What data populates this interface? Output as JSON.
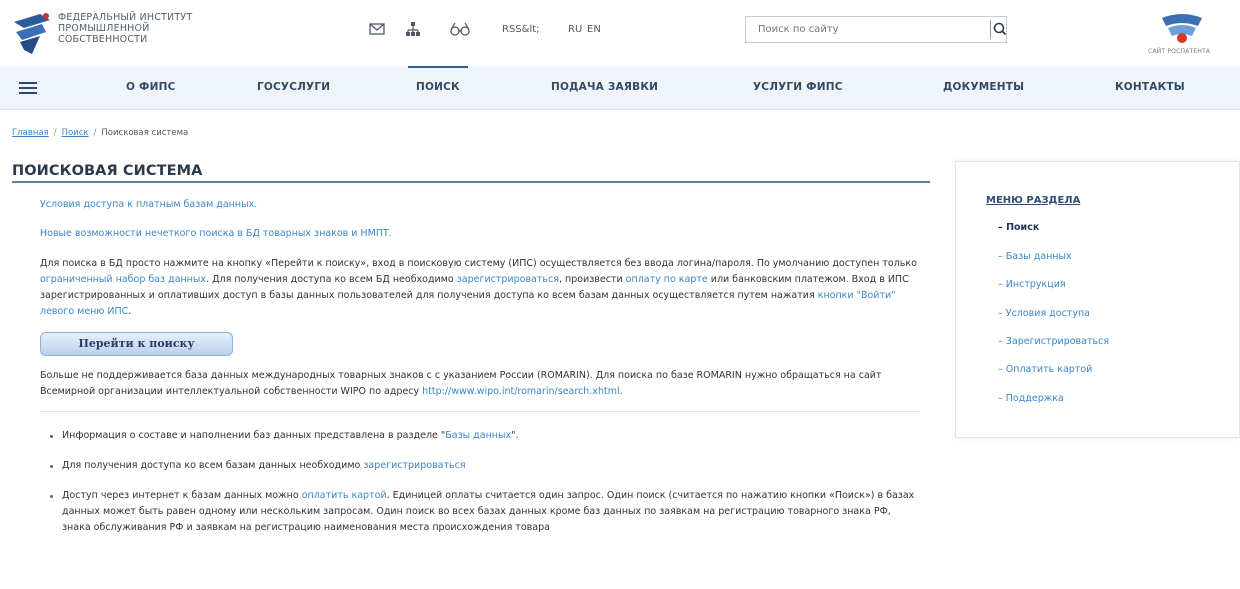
{
  "header": {
    "logo_text": [
      "ФЕДЕРАЛЬНЫЙ ИНСТИТУТ",
      "ПРОМЫШЛЕННОЙ",
      "СОБСТВЕННОСТИ"
    ],
    "rss_label": "RSS&lt;",
    "lang_ru": "RU",
    "lang_en": "EN",
    "search_placeholder": "Поиск по сайту",
    "patent_label": "САЙТ РОСПАТЕНТА"
  },
  "nav": {
    "items": [
      "О ФИПС",
      "ГОСУСЛУГИ",
      "ПОИСК",
      "ПОДАЧА ЗАЯВКИ",
      "УСЛУГИ ФИПС",
      "ДОКУМЕНТЫ",
      "КОНТАКТЫ"
    ],
    "active": "ПОИСК"
  },
  "breadcrumb": [
    "Главная",
    "Поиск",
    "Поисковая система"
  ],
  "page_title": "ПОИСКОВАЯ СИСТЕМА",
  "content": {
    "link1": "Условия доступа к платным базам данных.",
    "link2": "Новые возможности нечеткого поиска в БД товарных знаков и НМПТ.",
    "p1_a": "Для поиска в БД просто нажмите на кнопку «Перейти к поиску», вход в поисковую систему (ИПС) осуществляется без ввода логина/пароля. По умолчанию доступен только ",
    "p1_link1": "ограниченный набор баз данных",
    "p1_b": ". Для получения доступа ко всем БД необходимо ",
    "p1_link2": "зарегистрироваться",
    "p1_c": ", произвести ",
    "p1_link3": "оплату по карте",
    "p1_d": " или банковским платежом. Вход в ИПС зарегистрированных и оплативших доступ в базы данных пользователей для получения доступа ко всем базам данных осуществляется путем нажатия ",
    "p1_link4": "кнопки \"Войти\" левого меню ИПС",
    "p1_e": ".",
    "goto_button": "Перейти к поиску",
    "p2_a": "Больше не поддерживается база данных международных товарных знаков с с указанием России (ROMARIN). Для поиска по базе ROMARIN нужно обращаться на сайт Всемирной организации интеллектуальной собственности WIPO по адресу ",
    "p2_link": "http://www.wipo.int/romarin/search.xhtml",
    "p2_b": ".",
    "b1_a": "Информация о составе и наполнении баз данных представлена в разделе \"",
    "b1_link": "Базы данных",
    "b1_b": "\".",
    "b2_a": "Для получения доступа ко всем базам данных необходимо ",
    "b2_link": "зарегистрироваться",
    "b3_a": "Доступ через интернет к базам данных можно ",
    "b3_link": "оплатить картой",
    "b3_b": ". Единицей оплаты считается один запрос. Один поиск (считается по нажатию кнопки «Поиск») в базах данных может быть равен одному или нескольким запросам. Один поиск во всех базах данных кроме баз данных по заявкам на регистрацию товарного знака РФ, знака обслуживания РФ и заявкам на регистрацию наименования места происхождения товара"
  },
  "side_menu": {
    "title": "МЕНЮ РАЗДЕЛА",
    "items": [
      "Поиск",
      "Базы данных",
      "Инструкция",
      "Условия доступа",
      "Зарегистрироваться",
      "Оплатить картой",
      "Поддержка"
    ]
  },
  "colors": {
    "link": "#3b86c9",
    "nav_bg": "#eef4fa",
    "accent": "#2d5d9a"
  }
}
